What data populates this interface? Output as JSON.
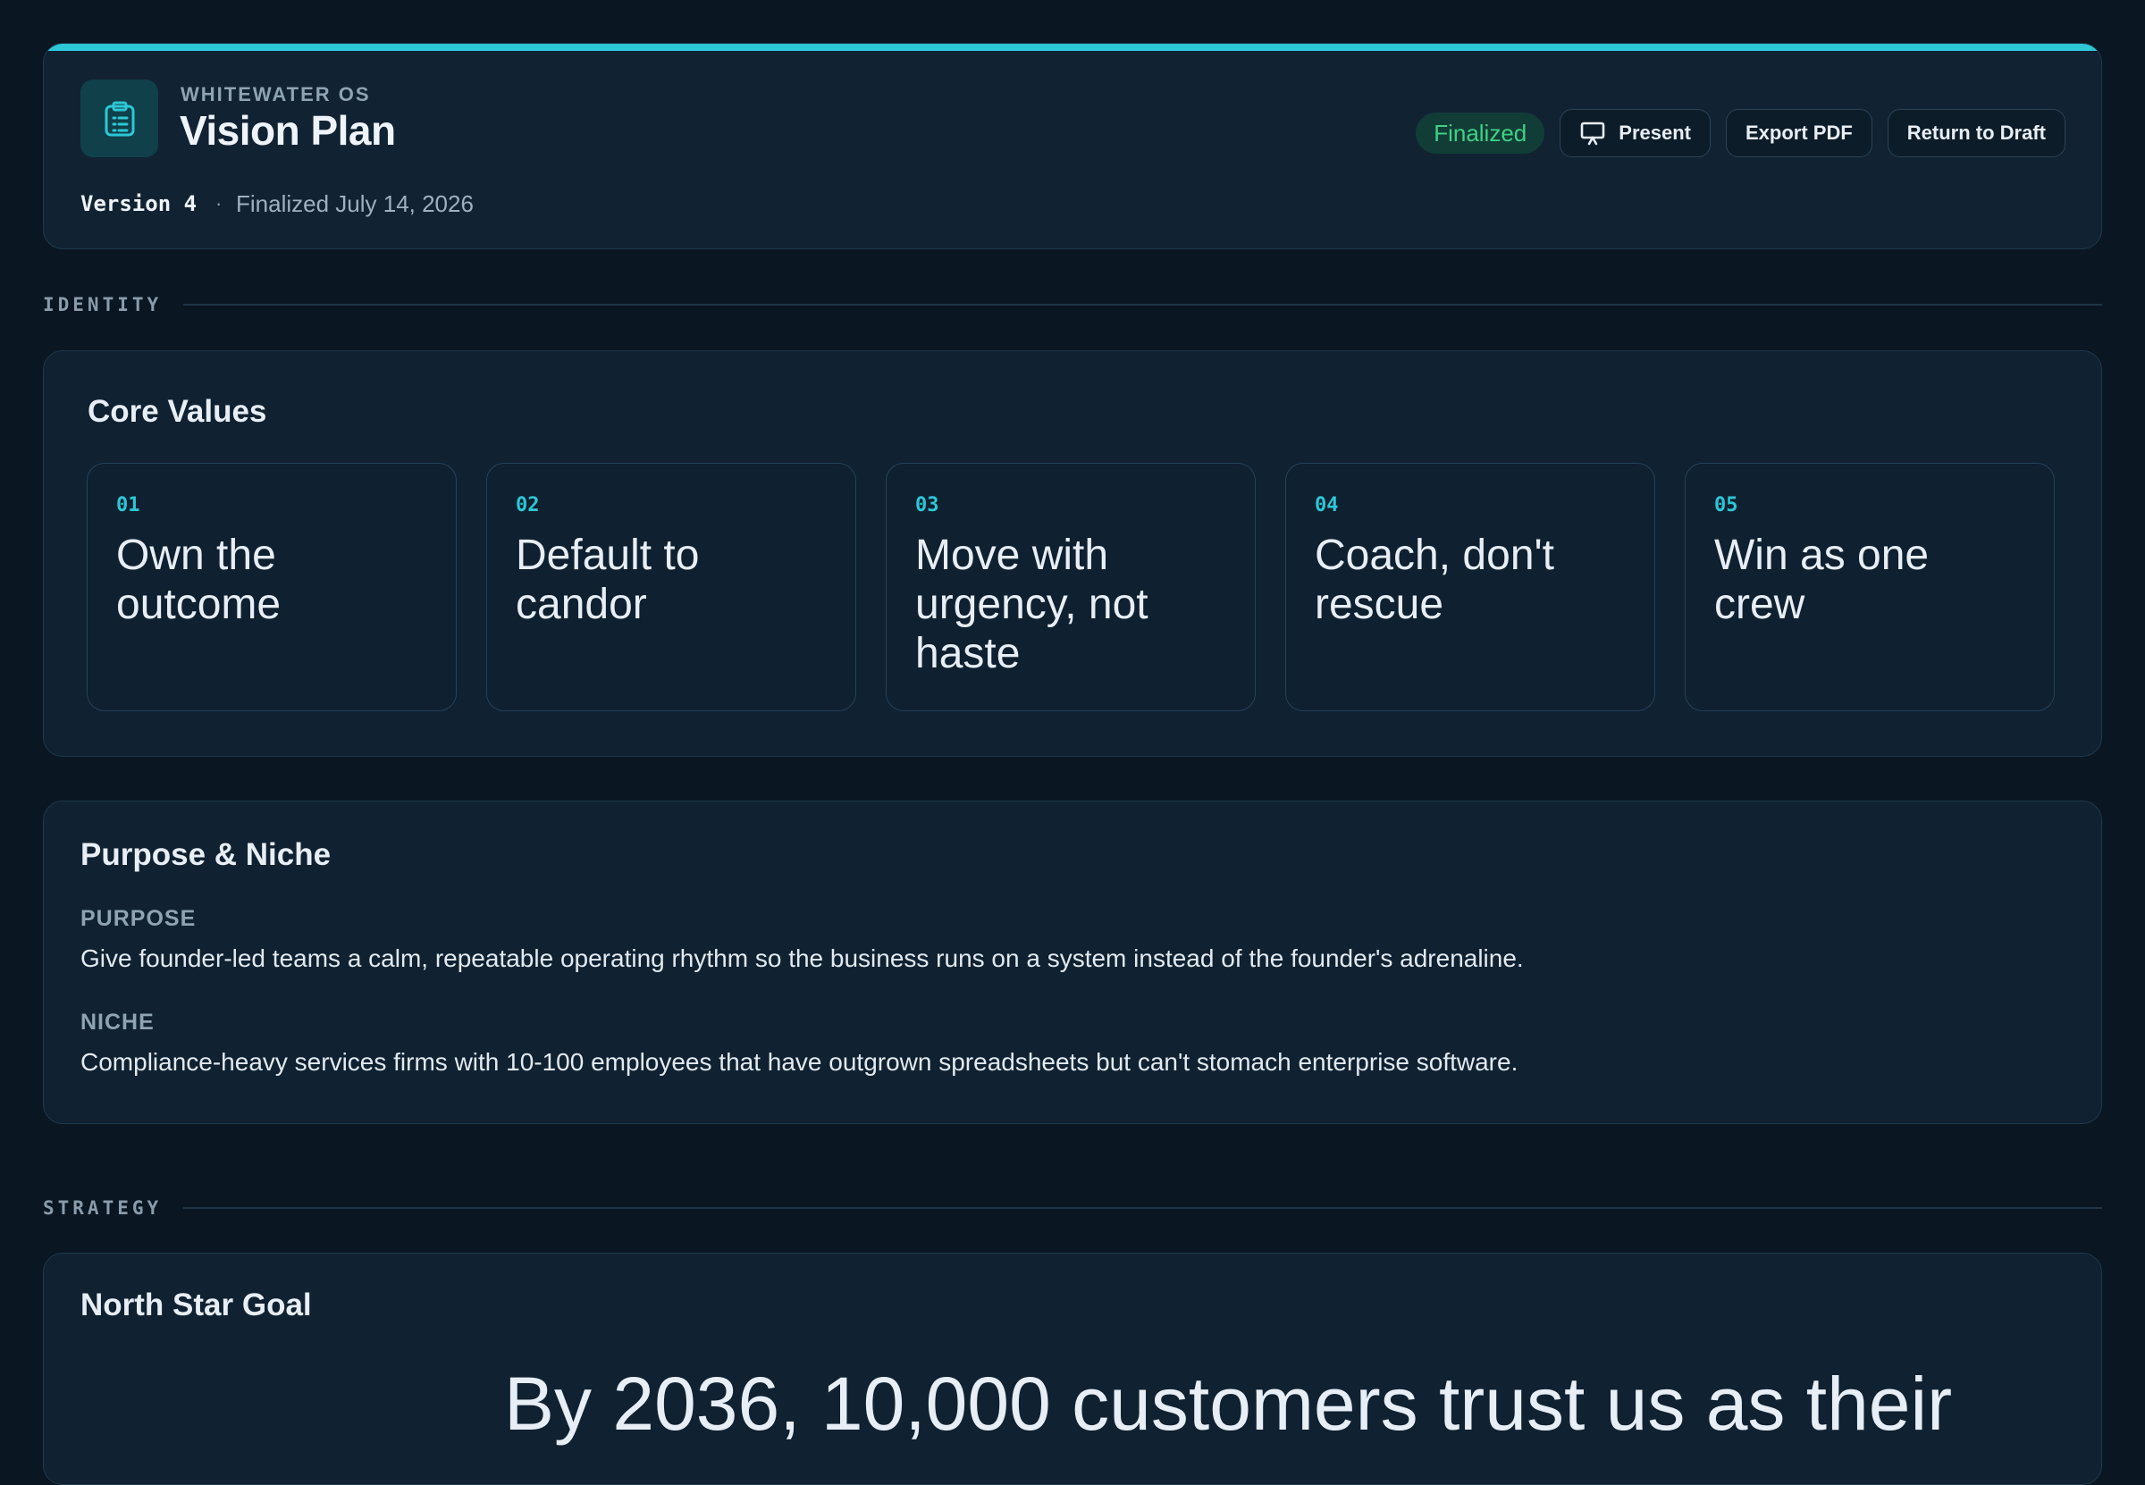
{
  "app": {
    "name": "WHITEWATER OS"
  },
  "page": {
    "title": "Vision Plan",
    "version": "Version 4",
    "separator": "·",
    "finalized_date": "Finalized July 14, 2026",
    "status_badge": "Finalized"
  },
  "actions": {
    "present": "Present",
    "export_pdf": "Export PDF",
    "return_to_draft": "Return to Draft"
  },
  "sections": {
    "identity": "IDENTITY",
    "strategy": "STRATEGY"
  },
  "core_values": {
    "title": "Core Values",
    "items": [
      {
        "num": "01",
        "text": "Own the outcome"
      },
      {
        "num": "02",
        "text": "Default to candor"
      },
      {
        "num": "03",
        "text": "Move with urgency, not haste"
      },
      {
        "num": "04",
        "text": "Coach, don't rescue"
      },
      {
        "num": "05",
        "text": "Win as one crew"
      }
    ]
  },
  "purpose_niche": {
    "title": "Purpose & Niche",
    "purpose_label": "PURPOSE",
    "purpose_text": "Give founder-led teams a calm, repeatable operating rhythm so the business runs on a system instead of the founder's adrenaline.",
    "niche_label": "NICHE",
    "niche_text": "Compliance-heavy services firms with 10-100 employees that have outgrown spreadsheets but can't stomach enterprise software."
  },
  "north_star": {
    "title": "North Star Goal",
    "text": "By 2036, 10,000 customers trust us as their"
  },
  "colors": {
    "accent": "#2dc7d6",
    "success": "#3fd186",
    "background": "#0a1621",
    "panel": "#102131"
  },
  "icons": {
    "logo": "clipboard-list-icon",
    "present": "presentation-screen-icon"
  }
}
